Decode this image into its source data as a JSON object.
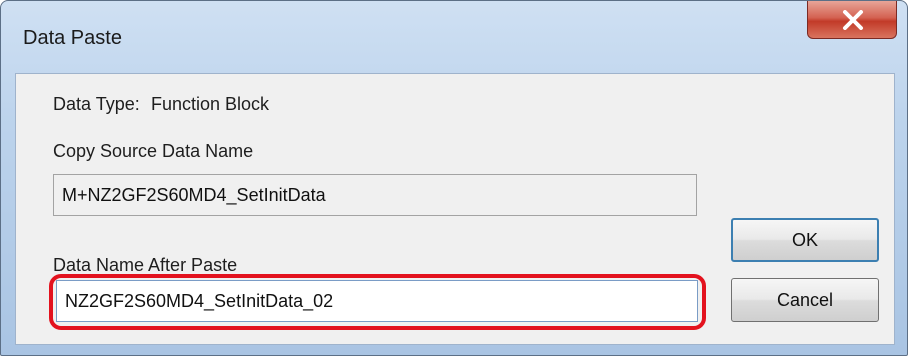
{
  "window": {
    "title": "Data Paste",
    "close_icon": "close-icon"
  },
  "info": {
    "data_type_label": "Data Type:",
    "data_type_value": "Function Block"
  },
  "copy_source": {
    "label": "Copy Source Data Name",
    "value": "M+NZ2GF2S60MD4_SetInitData"
  },
  "paste_target": {
    "label": "Data Name After Paste",
    "value": "NZ2GF2S60MD4_SetInitData_02"
  },
  "buttons": {
    "ok": "OK",
    "cancel": "Cancel"
  },
  "colors": {
    "highlight": "#e3121e",
    "close_button": "#c23a28"
  }
}
